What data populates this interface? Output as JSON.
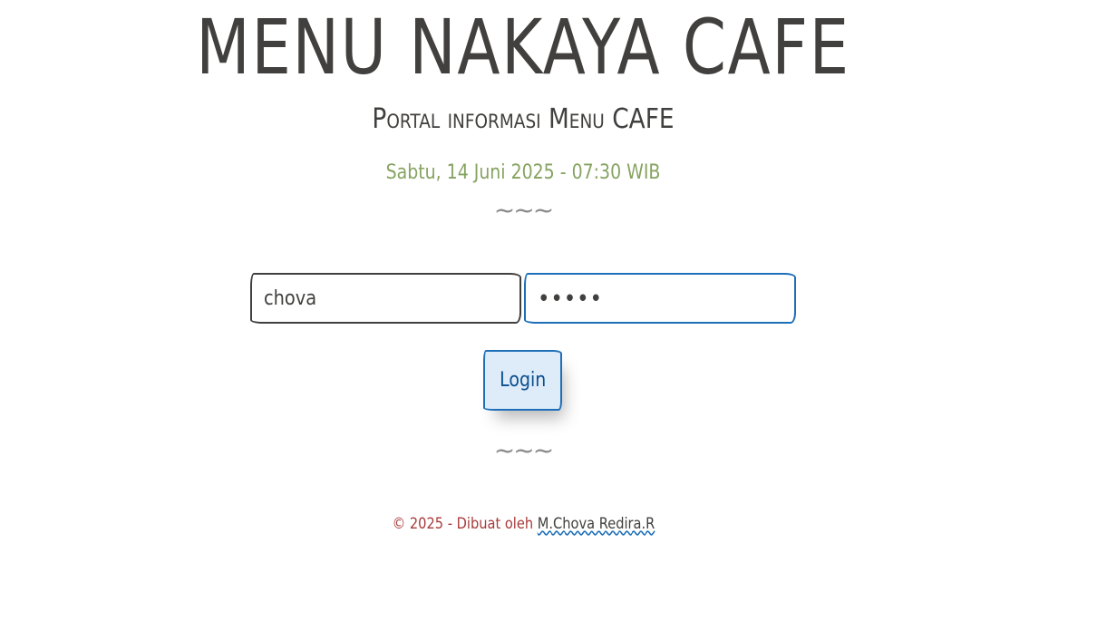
{
  "header": {
    "title": "MENU NAKAYA CAFE",
    "subtitle": "Portal informasi Menu CAFE",
    "datetime": "Sabtu, 14 Juni 2025 - 07:30 WIB",
    "divider": "~~~"
  },
  "login_form": {
    "username_value": "chova",
    "password_value": "•••••",
    "login_label": "Login"
  },
  "footer": {
    "divider": "~~~",
    "prefix": "© 2025 - Dibuat oleh ",
    "author_link": "M.Chova Redira.R"
  },
  "colors": {
    "text": "#41403e",
    "datetime": "#86a361",
    "accent": "#1d6fb8",
    "button_bg": "#deebf8",
    "footer_text": "#a83a3a"
  }
}
